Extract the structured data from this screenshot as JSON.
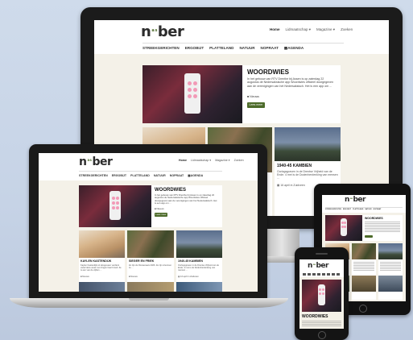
{
  "site": {
    "logo_part1": "n",
    "logo_small": "a s",
    "logo_part2": "ber",
    "topnav": [
      "Home",
      "Lidmaatschap ▾",
      "Magazine ▾",
      "Zoeken"
    ],
    "mainnav": [
      "STREEKGERICHTEN",
      "ERGOBIJT",
      "PLATTELAND",
      "NATUUR",
      "NOPRAAT",
      "AGENDA"
    ],
    "mainnav_short": [
      "STREEKGERICHTEN",
      "ERGOBIJT",
      "PLATTELAND",
      "NATUUR",
      "NOPRAAT",
      "AGENDA"
    ]
  },
  "featured": {
    "title": "WOORDWIES",
    "text": "In het gebouw van RTV Drenthe bij Assen is op zaterdag 22 augustus de Nedersaksische app Woordwies officieel doorgegeven aan de verenigingen van het Nedersaksisch. Het is een app om ...",
    "meta": "Nieuws",
    "button": "Lees meer"
  },
  "tiles": [
    {
      "title": "KAYLEN KASTENDIJK",
      "text": "Kaylen Kastendijk uit Hoogeveen verdient vanaf deze week met zingen haar brood. Ze is een van de vijftien ...",
      "meta": "Nieuws"
    },
    {
      "title": "SIEGER EN FRIEK",
      "text": "Ze zijn de Ronsenaars 2026. Ze zijn vriend-en ze ...",
      "meta": "Nieuws"
    },
    {
      "title": "1940-45 KAMBIEN",
      "text": "Oorlogsgraven in de Drentse Vrijheid van de Ende. 4 mei is de Dodenherdenking van mensen ...",
      "meta": "16 april in Zuidveen"
    }
  ],
  "phone_title": "WOORDWIES"
}
